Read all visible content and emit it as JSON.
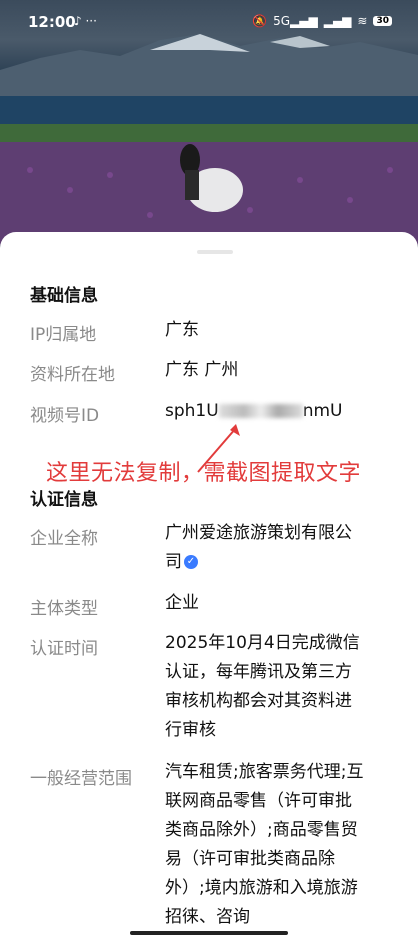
{
  "status": {
    "time": "12:00",
    "left_icons": "♪ ···",
    "signal": "5G",
    "battery": "30"
  },
  "sections": {
    "basic": {
      "title": "基础信息",
      "rows": [
        {
          "label": "IP归属地",
          "value": "广东"
        },
        {
          "label": "资料所在地",
          "value": "广东 广州"
        },
        {
          "label": "视频号ID",
          "value_prefix": "sph1U",
          "value_suffix": "nmU"
        }
      ]
    },
    "annotation": "这里无法复制，需截图提取文字",
    "cert": {
      "title": "认证信息",
      "rows": [
        {
          "label": "企业全称",
          "value": "广州爱途旅游策划有限公司"
        },
        {
          "label": "主体类型",
          "value": "企业"
        },
        {
          "label": "认证时间",
          "value": "2025年10月4日完成微信认证，每年腾讯及第三方审核机构都会对其资料进行审核"
        },
        {
          "label": "一般经营范围",
          "value": "汽车租赁;旅客票务代理;互联网商品零售（许可审批类商品除外）;商品零售贸易（许可审批类商品除外）;境内旅游和入境旅游招徕、咨询"
        }
      ]
    }
  },
  "colors": {
    "annotation": "#e23b3b",
    "label": "#8a8a8a",
    "verified": "#3a7bff"
  }
}
